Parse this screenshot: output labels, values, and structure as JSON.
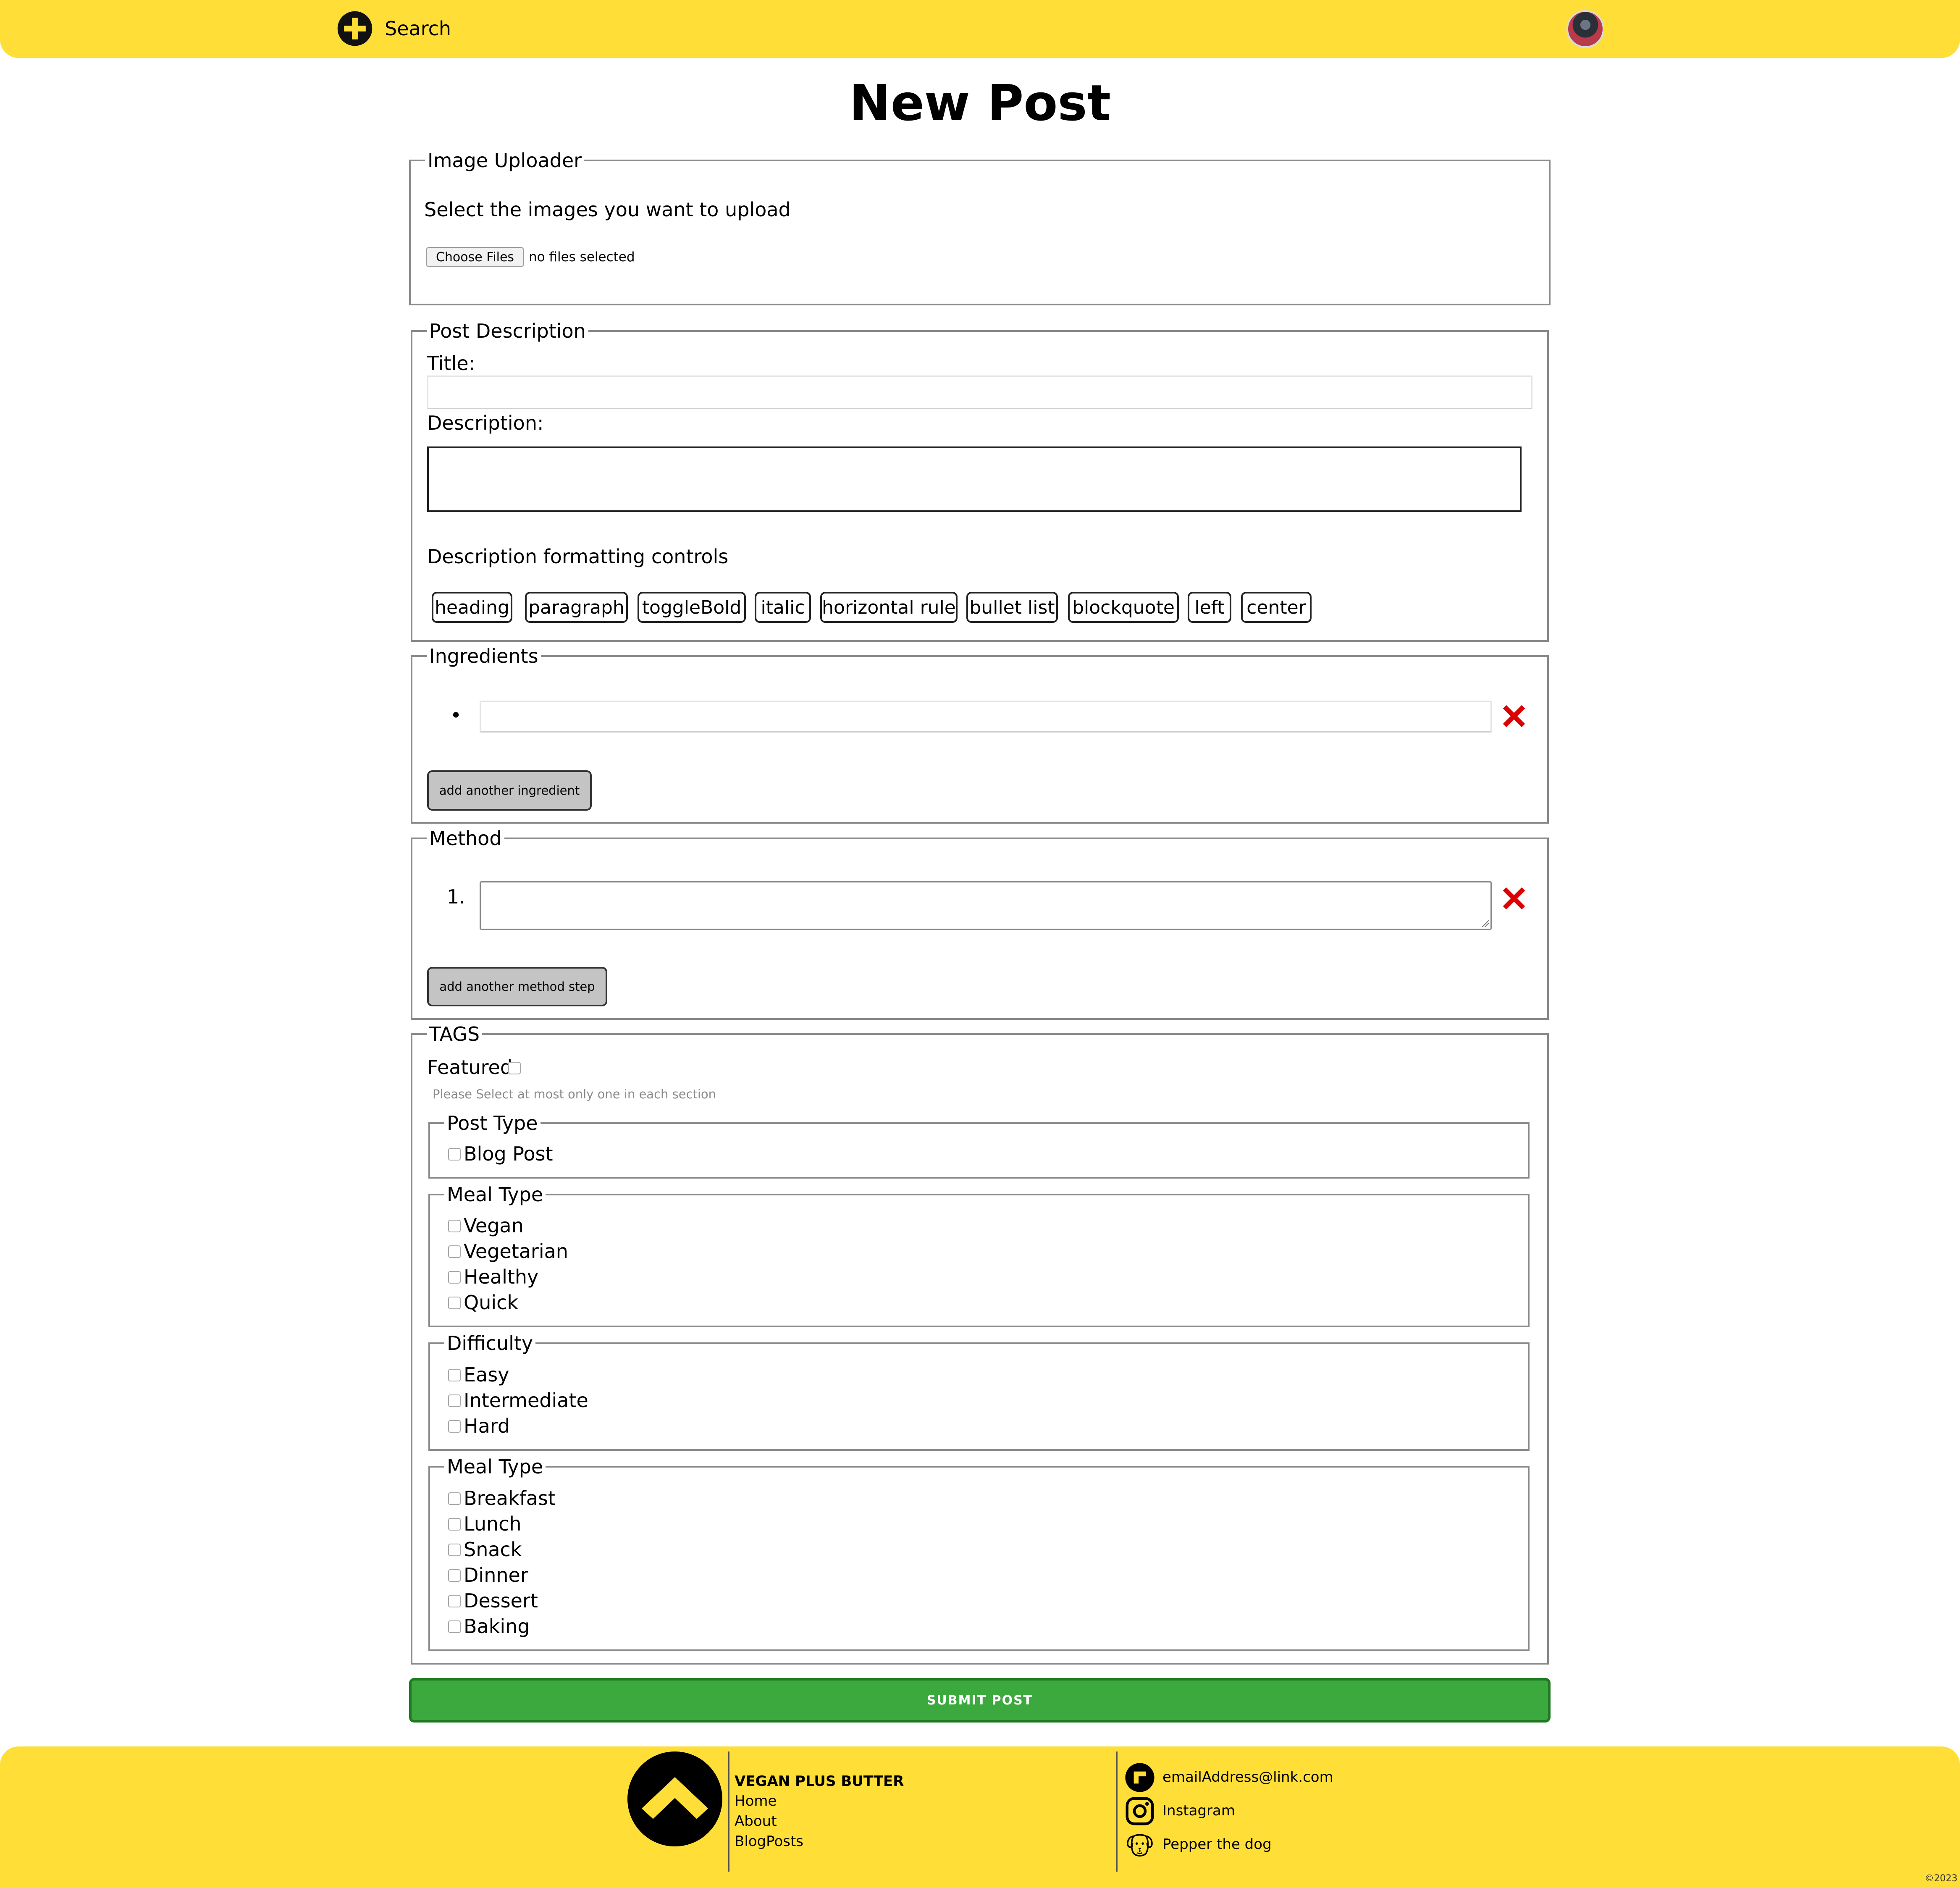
{
  "header": {
    "search_label": "Search"
  },
  "page_title": "New Post",
  "image_uploader": {
    "legend": "Image Uploader",
    "instruction": "Select the images you want to upload",
    "choose_files_label": "Choose Files",
    "file_status": "no files selected"
  },
  "post_description": {
    "legend": "Post Description",
    "title_label": "Title:",
    "description_label": "Description:",
    "formatting_label": "Description formatting controls",
    "formatting_buttons": [
      "heading",
      "paragraph",
      "toggleBold",
      "italic",
      "horizontal rule",
      "bullet list",
      "blockquote",
      "left",
      "center"
    ]
  },
  "ingredients": {
    "legend": "Ingredients",
    "bullet": "•",
    "add_label": "add another ingredient"
  },
  "method": {
    "legend": "Method",
    "step_number": "1.",
    "add_label": "add another method step"
  },
  "tags": {
    "legend": "TAGS",
    "featured_label": "Featured",
    "hint": "Please Select at most only one in each section",
    "groups": [
      {
        "legend": "Post Type",
        "options": [
          "Blog Post"
        ]
      },
      {
        "legend": "Meal Type",
        "options": [
          "Vegan",
          "Vegetarian",
          "Healthy",
          "Quick"
        ]
      },
      {
        "legend": "Difficulty",
        "options": [
          "Easy",
          "Intermediate",
          "Hard"
        ]
      },
      {
        "legend": "Meal Type",
        "options": [
          "Breakfast",
          "Lunch",
          "Snack",
          "Dinner",
          "Dessert",
          "Baking"
        ]
      }
    ]
  },
  "submit_label": "SUBMIT POST",
  "footer": {
    "brand": "VEGAN PLUS BUTTER",
    "nav": [
      "Home",
      "About",
      "BlogPosts"
    ],
    "contacts": [
      "emailAddress@link.com",
      "Instagram",
      "Pepper the dog"
    ],
    "copyright": "©2023"
  },
  "colors": {
    "brand_yellow": "#FFDF37",
    "submit_green": "#3CA93E",
    "remove_red": "#DD0000"
  }
}
